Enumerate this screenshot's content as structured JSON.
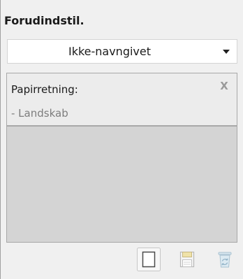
{
  "panel": {
    "title": "Forudindstil."
  },
  "preset": {
    "selected": "Ikke-navngivet",
    "arrow_icon": "dropdown-arrow"
  },
  "settings": {
    "items": [
      {
        "label": "Papirretning:",
        "value": "- Landskab",
        "close_glyph": "X"
      }
    ]
  },
  "toolbar": {
    "buttons": [
      {
        "name": "new-preset",
        "icon": "blank-page-icon",
        "enabled": true
      },
      {
        "name": "save-preset",
        "icon": "floppy-disk-icon",
        "enabled": false
      },
      {
        "name": "delete-preset",
        "icon": "trash-bin-icon",
        "enabled": false
      }
    ]
  },
  "colors": {
    "panel_bg": "#f0f0f0",
    "settings_bg": "#d4d4d4",
    "disabled_icon": "#b4b4b4"
  }
}
